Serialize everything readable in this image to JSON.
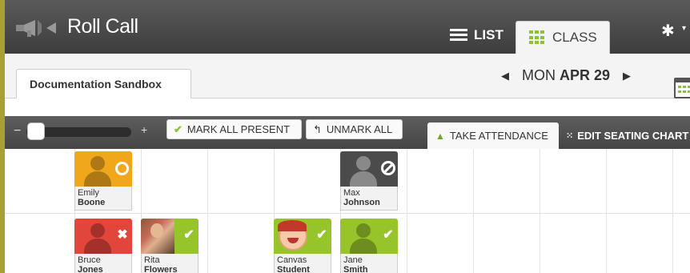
{
  "app": {
    "title": "Roll Call"
  },
  "header": {
    "list_label": "LIST",
    "class_label": "CLASS",
    "settings_icon": "gear-icon"
  },
  "course": {
    "tab_label": "Documentation Sandbox"
  },
  "date_nav": {
    "day": "MON",
    "date": "APR 29",
    "prev_glyph": "◀",
    "next_glyph": "▶"
  },
  "toolbar": {
    "minus": "−",
    "plus": "+",
    "mark_all_present": "MARK ALL PRESENT",
    "unmark_all": "UNMARK ALL",
    "take_attendance": "TAKE ATTENDANCE",
    "edit_seating_chart": "EDIT SEATING CHART",
    "zoom_level": 0.0
  },
  "students": [
    {
      "first": "Emily",
      "last": "Boone",
      "status": "late",
      "color": "#f1a71c"
    },
    {
      "first": "Max",
      "last": "Johnson",
      "status": "unmarked",
      "color": "#4b4b4b"
    },
    {
      "first": "Bruce",
      "last": "Jones",
      "status": "absent",
      "color": "#e2453a"
    },
    {
      "first": "Rita",
      "last": "Flowers",
      "status": "present",
      "color": "#97c42b"
    },
    {
      "first": "Canvas",
      "last": "Student",
      "status": "present",
      "color": "#97c42b"
    },
    {
      "first": "Jane",
      "last": "Smith",
      "status": "present",
      "color": "#97c42b"
    }
  ],
  "colors": {
    "accent_green": "#8ac52c",
    "header_bg": "#4a4a4a"
  }
}
